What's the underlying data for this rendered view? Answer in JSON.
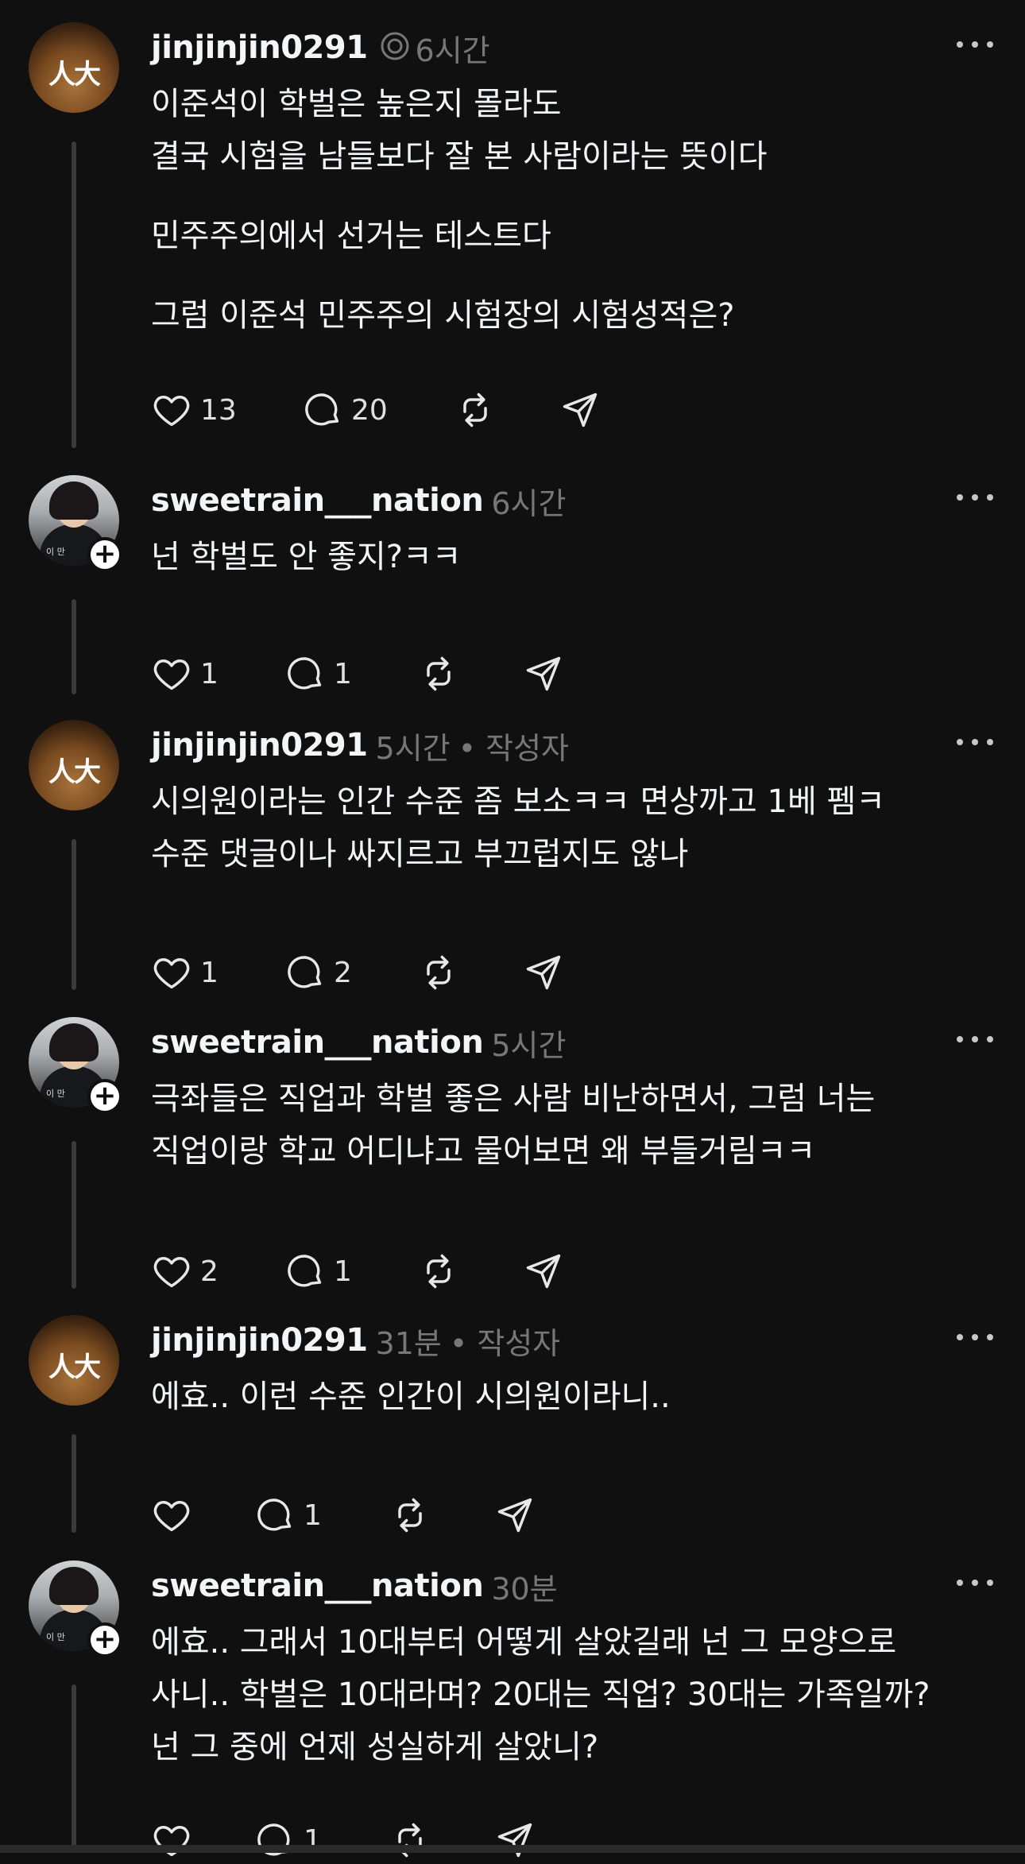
{
  "posts": [
    {
      "username": "jinjinjin0291",
      "time": "6시간",
      "author_tag": "",
      "has_thread_icon": true,
      "avatar": "av-a",
      "lines": [
        "이준석이 학벌은 높은지 몰라도",
        "결국 시험을 남들보다 잘 본 사람이라는 뜻이다",
        "민주주의에서 선거는 테스트다",
        "그럼 이준석 민주주의 시험장의 시험성적은?"
      ],
      "likes": "13",
      "replies": "20"
    },
    {
      "username": "sweetrain___nation",
      "time": "6시간",
      "author_tag": "",
      "avatar": "av-b",
      "avatar_tag": "이 만",
      "lines": [
        "넌 학벌도 안 좋지?ㅋㅋ"
      ],
      "likes": "1",
      "replies": "1"
    },
    {
      "username": "jinjinjin0291",
      "time": "5시간",
      "author_tag": "• 작성자",
      "avatar": "av-a",
      "lines": [
        "시의원이라는 인간 수준 좀 보소ㅋㅋ 면상까고 1베 펨ㅋ",
        "수준 댓글이나 싸지르고 부끄럽지도 않나"
      ],
      "likes": "1",
      "replies": "2"
    },
    {
      "username": "sweetrain___nation",
      "time": "5시간",
      "author_tag": "",
      "avatar": "av-b",
      "avatar_tag": "이 만",
      "lines": [
        "극좌들은 직업과 학벌 좋은 사람 비난하면서, 그럼 너는",
        "직업이랑 학교 어디냐고 물어보면 왜 부들거림ㅋㅋ"
      ],
      "likes": "2",
      "replies": "1"
    },
    {
      "username": "jinjinjin0291",
      "time": "31분",
      "author_tag": "• 작성자",
      "avatar": "av-a",
      "lines": [
        "에효.. 이런 수준 인간이 시의원이라니.."
      ],
      "likes": "",
      "replies": "1"
    },
    {
      "username": "sweetrain___nation",
      "time": "30분",
      "author_tag": "",
      "avatar": "av-b",
      "avatar_tag": "이 만",
      "lines": [
        "에효.. 그래서 10대부터 어떻게 살았길래 넌 그 모양으로",
        "사니.. 학벌은 10대라며? 20대는 직업? 30대는 가족일까?",
        "넌 그 중에 언제 성실하게 살았니?"
      ],
      "likes": "",
      "replies": "1"
    }
  ],
  "avatar_logo_text": "人大",
  "icons": {
    "like": "heart-icon",
    "reply": "comment-icon",
    "repost": "repost-icon",
    "share": "send-icon",
    "more": "more-icon",
    "thread": "threads-icon"
  },
  "colors": {
    "background": "#101010",
    "text": "#f3f5f7",
    "meta": "#777777"
  }
}
